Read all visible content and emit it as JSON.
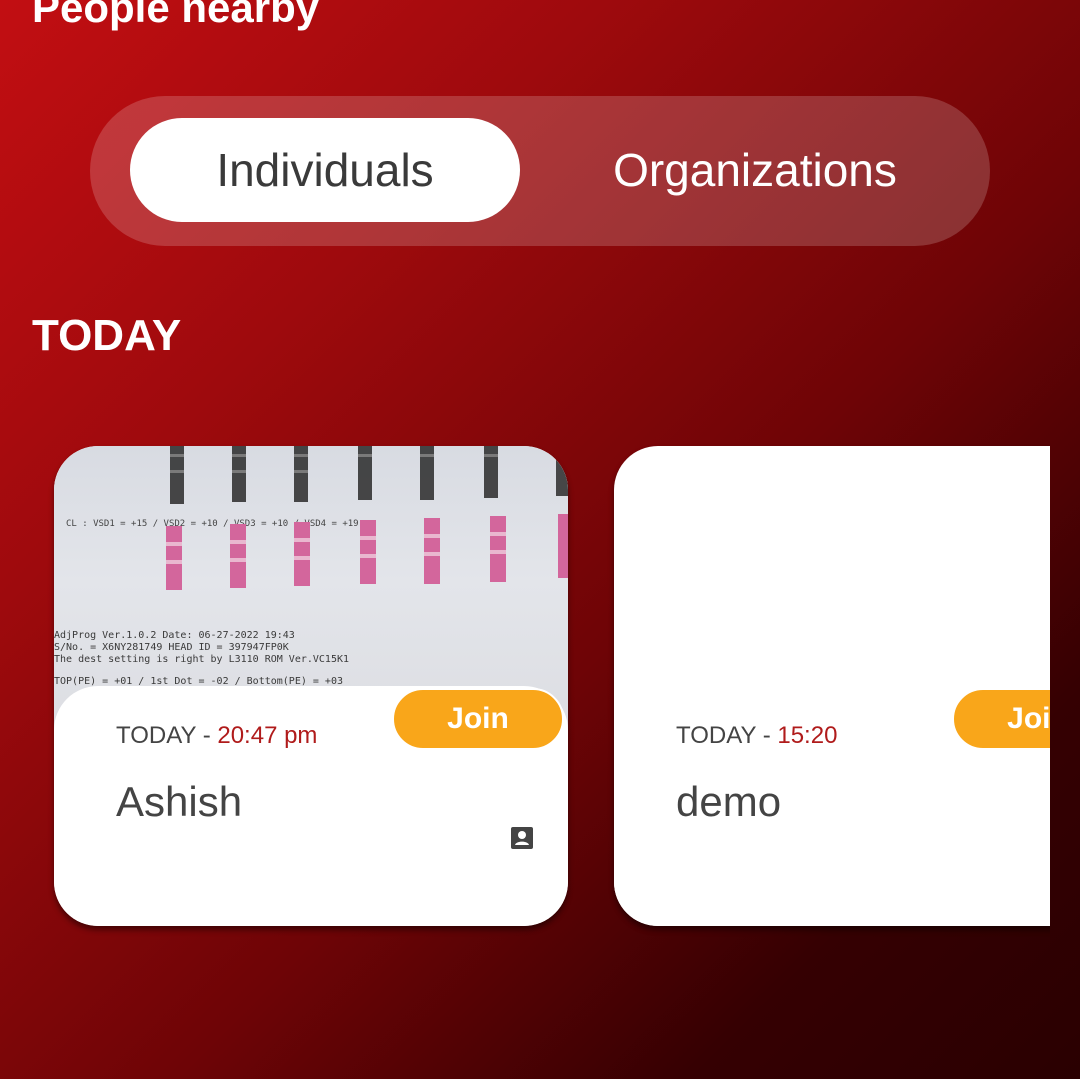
{
  "header": {
    "title": "People nearby"
  },
  "tabs": [
    {
      "label": "Individuals",
      "selected": true
    },
    {
      "label": "Organizations",
      "selected": false
    }
  ],
  "section": {
    "label": "TODAY"
  },
  "cards": [
    {
      "day": "TODAY",
      "separator": " - ",
      "time": "20:47 pm",
      "name": "Ashish",
      "join_label": "Join",
      "icon": "contact-card-icon",
      "photo": {
        "line1": "CL : VSD1 = +15  /  VSD2 = +10  /  VSD3 = +10  /  VSD4 = +19",
        "line2": "AdjProg Ver.1.0.2  Date: 06-27-2022 19:43",
        "line3": "S/No. = X6NY281749  HEAD ID = 397947FP0K",
        "line4": "The dest setting is right by L3110 ROM Ver.VC15K1",
        "line5": "TOP(PE) = +01 / 1st Dot = -02 / Bottom(PE) = +03"
      }
    },
    {
      "day": "TODAY",
      "separator": " - ",
      "time": "15:20",
      "name": "demo",
      "join_label": "Join"
    }
  ],
  "colors": {
    "accent_join": "#f9a61a",
    "time_text": "#b01b1b",
    "background_start": "#c20e12",
    "background_end": "#2a0001"
  }
}
